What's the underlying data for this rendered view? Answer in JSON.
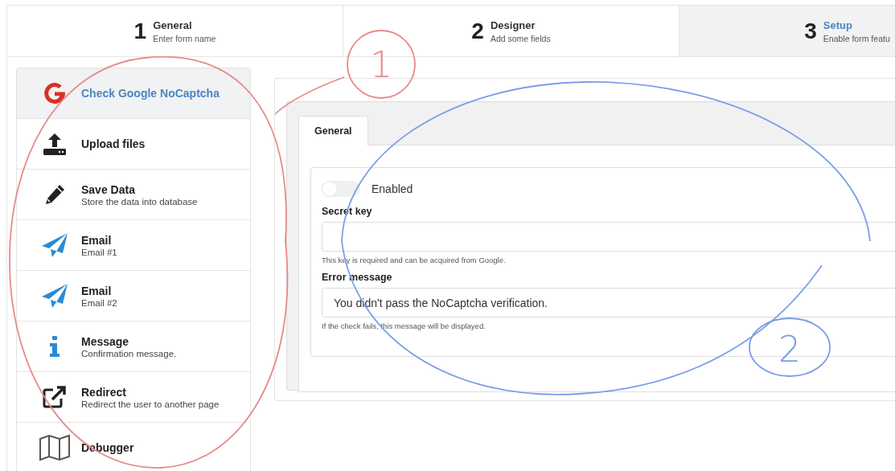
{
  "steps": [
    {
      "number": "1",
      "title": "General",
      "subtitle": "Enter form name",
      "selected": false
    },
    {
      "number": "2",
      "title": "Designer",
      "subtitle": "Add some fields",
      "selected": false
    },
    {
      "number": "3",
      "title": "Setup",
      "subtitle": "Enable form featu",
      "selected": true
    }
  ],
  "sidebar": {
    "items": [
      {
        "kind": "google",
        "title": "Check Google NoCaptcha",
        "selected": true
      },
      {
        "kind": "upload",
        "title": "Upload files",
        "selected": false
      },
      {
        "kind": "pencil",
        "title": "Save Data",
        "subtitle": "Store the data into database",
        "selected": false
      },
      {
        "kind": "plane",
        "title": "Email",
        "subtitle": "Email #1",
        "selected": false
      },
      {
        "kind": "plane",
        "title": "Email",
        "subtitle": "Email #2",
        "selected": false
      },
      {
        "kind": "info",
        "title": "Message",
        "subtitle": "Confirmation message.",
        "selected": false
      },
      {
        "kind": "external",
        "title": "Redirect",
        "subtitle": "Redirect the user to another page",
        "selected": false
      },
      {
        "kind": "map",
        "title": "Debugger",
        "selected": false
      }
    ]
  },
  "panel": {
    "tabs": [
      {
        "label": "General",
        "selected": true
      }
    ],
    "toggle": {
      "label": "Enabled",
      "on": false
    },
    "fields": [
      {
        "label": "Secret key",
        "help": "This key is required and can be acquired from Google."
      },
      {
        "label": "Error message",
        "value": "You didn't pass the NoCaptcha verification.",
        "help": "If the check fails, this message will be displayed."
      }
    ]
  },
  "annotations": [
    {
      "label": "1",
      "color": "#e88a8a"
    },
    {
      "label": "2",
      "color": "#7a9de8"
    }
  ]
}
